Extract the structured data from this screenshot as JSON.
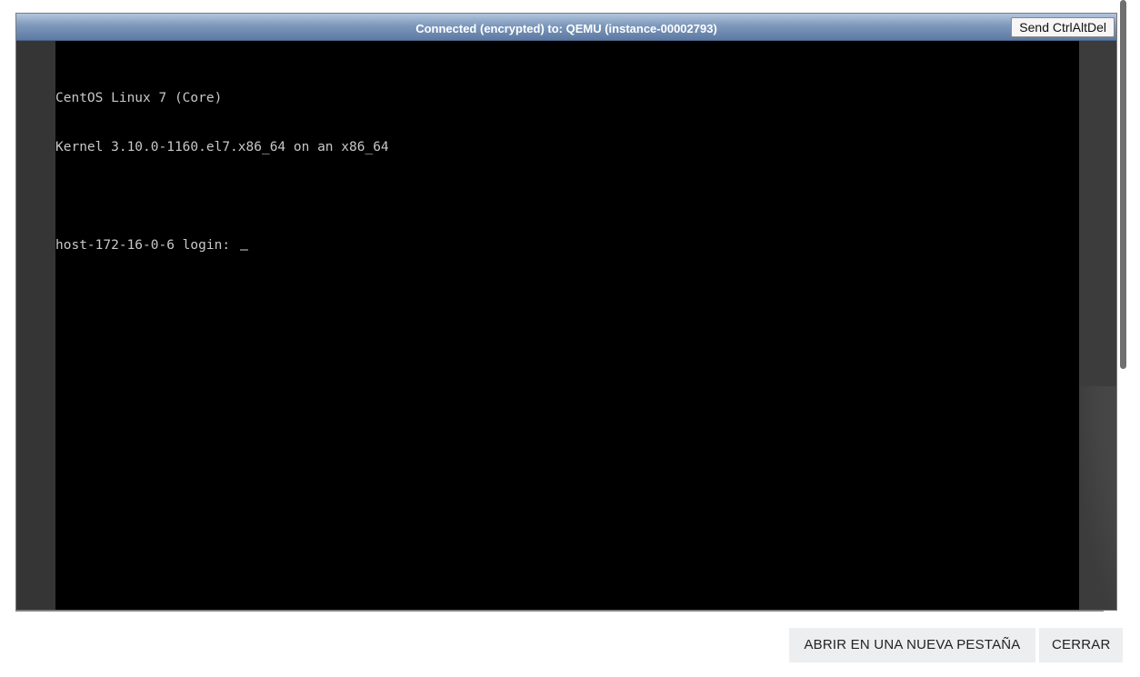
{
  "console": {
    "status_text": "Connected (encrypted) to: QEMU (instance-00002793)",
    "ctrlaltdel_label": "Send CtrlAltDel",
    "terminal_lines": [
      "CentOS Linux 7 (Core)",
      "Kernel 3.10.0-1160.el7.x86_64 on an x86_64",
      "",
      "host-172-16-0-6 login: "
    ]
  },
  "footer": {
    "open_new_tab_label": "ABRIR EN UNA NUEVA PESTAÑA",
    "close_label": "CERRAR"
  },
  "colors": {
    "status_bar_top": "#b3c6de",
    "status_bar_bottom": "#5c7aa3",
    "terminal_bg": "#000000",
    "terminal_text": "#c8c8c8",
    "frame_bg": "#353535",
    "footer_button_bg": "#eceeef"
  }
}
